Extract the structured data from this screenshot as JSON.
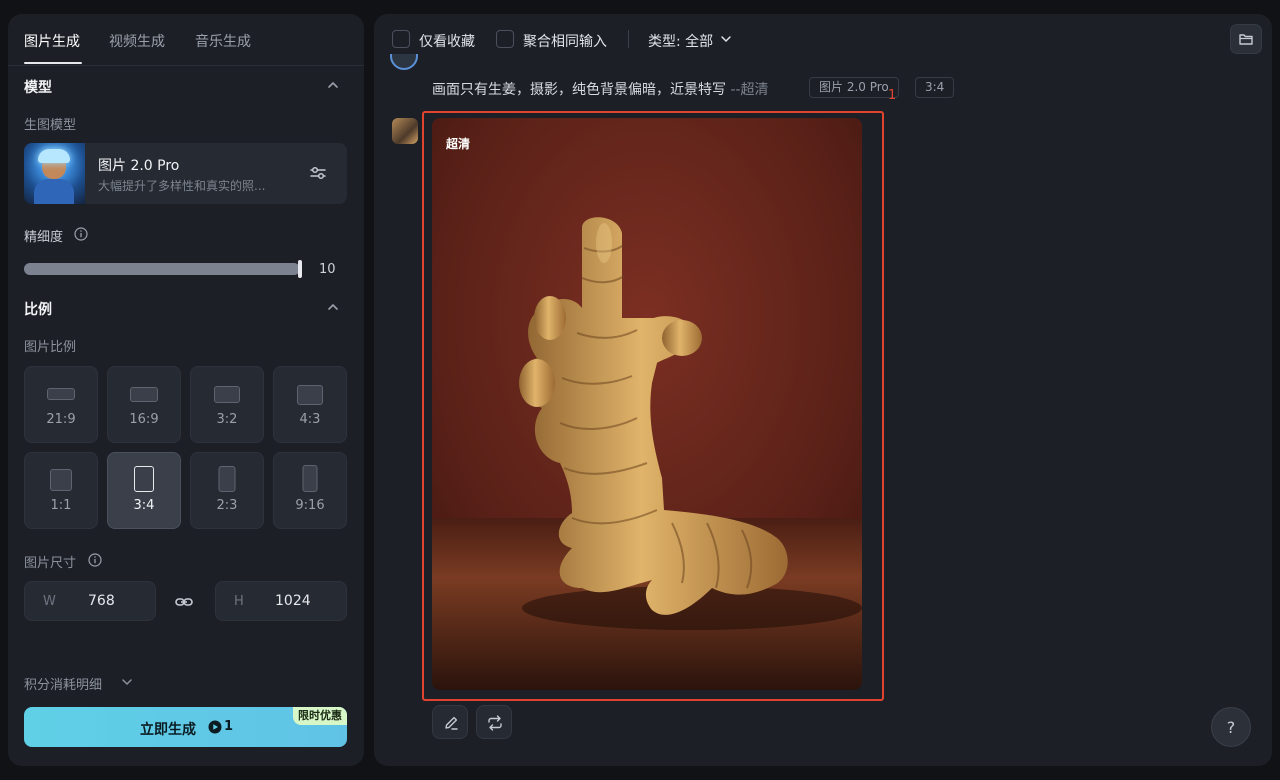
{
  "tabs": [
    "图片生成",
    "视频生成",
    "音乐生成"
  ],
  "model_section": {
    "title": "模型",
    "sub_label": "生图模型",
    "model_name": "图片 2.0 Pro",
    "model_desc": "大幅提升了多样性和真实的照..."
  },
  "precision": {
    "label": "精细度",
    "value": "10",
    "fill_fraction": 1.0
  },
  "ratio_section": {
    "title": "比例",
    "sub_label": "图片比例",
    "options": [
      "21:9",
      "16:9",
      "3:2",
      "4:3",
      "1:1",
      "3:4",
      "2:3",
      "9:16"
    ],
    "selected": "3:4"
  },
  "size": {
    "label": "图片尺寸",
    "w_prefix": "W",
    "w_value": "768",
    "h_prefix": "H",
    "h_value": "1024"
  },
  "cost_detail": "积分消耗明细",
  "generate": {
    "label": "立即生成",
    "credit": "1",
    "promo": "限时优惠"
  },
  "toolbar": {
    "favorites_only": "仅看收藏",
    "merge_same_input": "聚合相同输入",
    "type_filter": "类型: 全部"
  },
  "message": {
    "prompt": "画面只有生姜，摄影，纯色背景偏暗，近景特写",
    "prompt_suffix": "--超清",
    "model_tag": "图片 2.0 Pro",
    "ratio_tag": "3:4",
    "annotation": "1"
  },
  "result": {
    "quality_label": "超清"
  },
  "help": "?",
  "colors": {
    "accent": "#5fd0e6",
    "highlight": "#e0442f",
    "panel": "#1c1f26",
    "background": "#101216"
  }
}
